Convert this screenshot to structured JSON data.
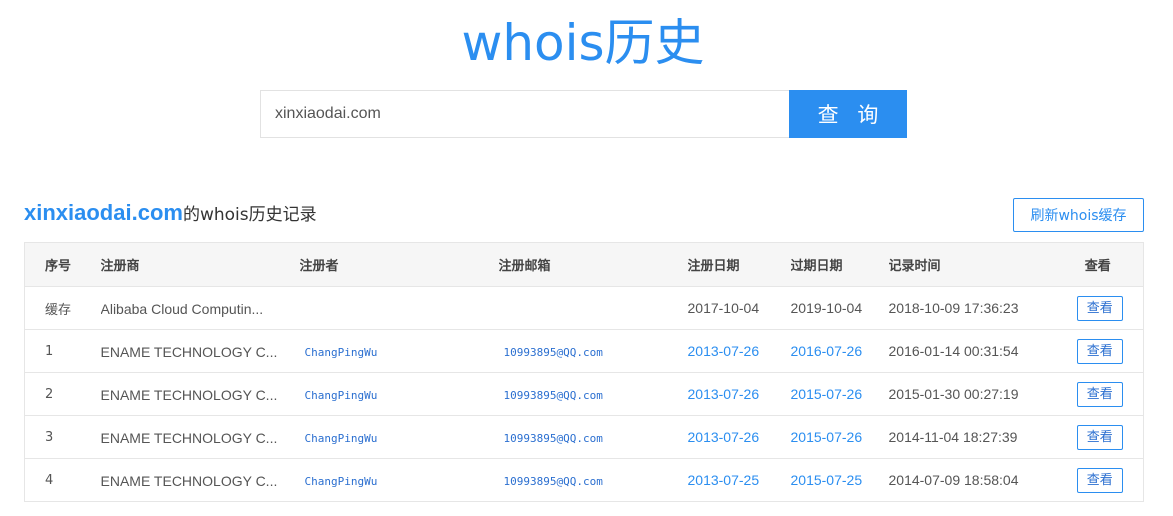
{
  "header": {
    "title": "whois历史"
  },
  "search": {
    "value": "xinxiaodai.com",
    "button_label": "查 询"
  },
  "section": {
    "domain": "xinxiaodai.com",
    "suffix": "的whois历史记录",
    "refresh_label": "刷新whois缓存"
  },
  "table": {
    "headers": [
      "序号",
      "注册商",
      "注册者",
      "注册邮箱",
      "注册日期",
      "过期日期",
      "记录时间",
      "查看"
    ],
    "rows": [
      {
        "index": "缓存",
        "registrar": "Alibaba Cloud Computin...",
        "registrant": "",
        "email": "",
        "reg_date": "2017-10-04",
        "exp_date": "2019-10-04",
        "record_time": "2018-10-09 17:36:23",
        "view_label": "查看"
      },
      {
        "index": "1",
        "registrar": "ENAME TECHNOLOGY C...",
        "registrant": "ChangPingWu",
        "email": "10993895@QQ.com",
        "reg_date": "2013-07-26",
        "exp_date": "2016-07-26",
        "record_time": "2016-01-14 00:31:54",
        "view_label": "查看"
      },
      {
        "index": "2",
        "registrar": "ENAME TECHNOLOGY C...",
        "registrant": "ChangPingWu",
        "email": "10993895@QQ.com",
        "reg_date": "2013-07-26",
        "exp_date": "2015-07-26",
        "record_time": "2015-01-30 00:27:19",
        "view_label": "查看"
      },
      {
        "index": "3",
        "registrar": "ENAME TECHNOLOGY C...",
        "registrant": "ChangPingWu",
        "email": "10993895@QQ.com",
        "reg_date": "2013-07-26",
        "exp_date": "2015-07-26",
        "record_time": "2014-11-04 18:27:39",
        "view_label": "查看"
      },
      {
        "index": "4",
        "registrar": "ENAME TECHNOLOGY C...",
        "registrant": "ChangPingWu",
        "email": "10993895@QQ.com",
        "reg_date": "2013-07-25",
        "exp_date": "2015-07-25",
        "record_time": "2014-07-09 18:58:04",
        "view_label": "查看"
      }
    ]
  },
  "colors": {
    "accent": "#2b8ef0",
    "link": "#2b6fd0",
    "header_bg": "#f6f6f6",
    "border": "#e6e6e6"
  }
}
